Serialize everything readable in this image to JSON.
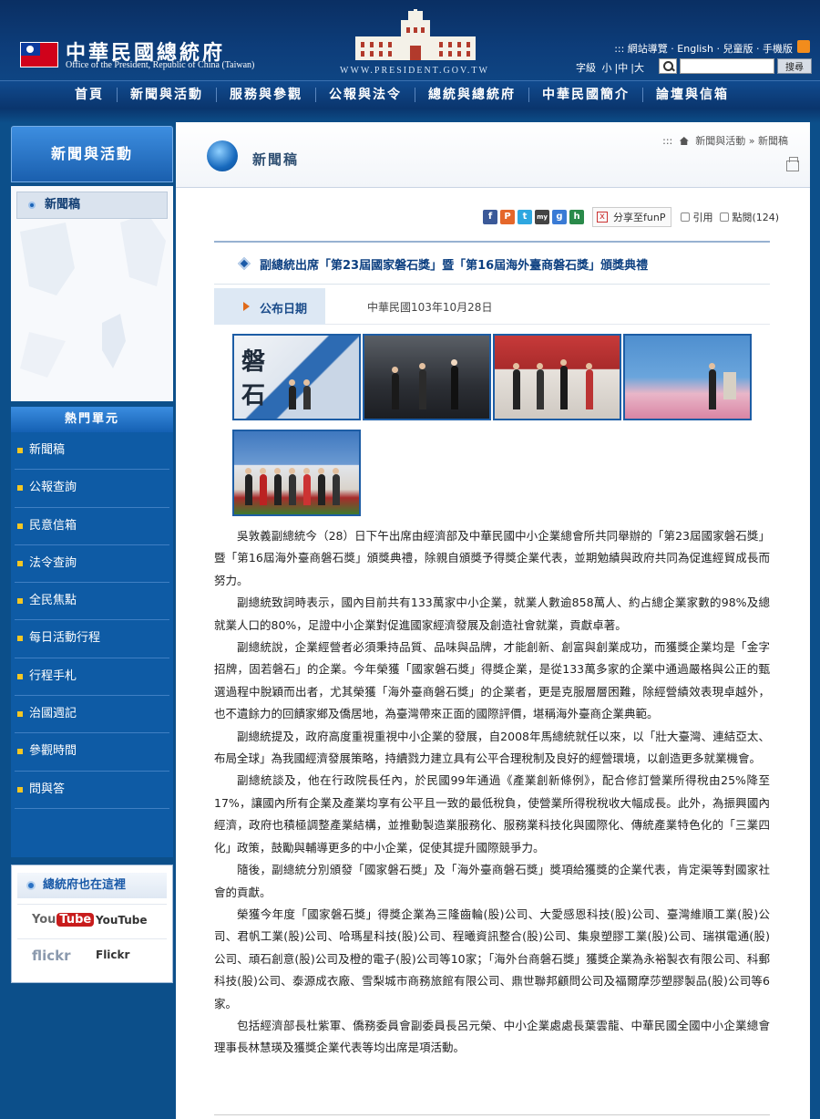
{
  "header": {
    "title": "中華民國總統府",
    "subtitle": "Office of the President, Republic of China (Taiwan)",
    "url": "WWW.PRESIDENT.GOV.TW",
    "top_links": "::: 網站導覽 · English · 兒童版 · 手機版",
    "font_size_label": "字級",
    "font_small": "小",
    "font_medium": "中",
    "font_large": "大",
    "search_placeholder": "",
    "search_button": "搜尋",
    "rss_label": "RSS"
  },
  "nav": {
    "items": [
      {
        "label": "首頁"
      },
      {
        "label": "新聞與活動"
      },
      {
        "label": "服務與參觀"
      },
      {
        "label": "公報與法令"
      },
      {
        "label": "總統與總統府"
      },
      {
        "label": "中華民國簡介"
      },
      {
        "label": "論壇與信箱"
      }
    ]
  },
  "sidebar": {
    "section_title": "新聞與活動",
    "submenu_item": "新聞稿",
    "hot_title": "熱門單元",
    "hot_items": [
      {
        "label": "新聞稿"
      },
      {
        "label": "公報查詢"
      },
      {
        "label": "民意信箱"
      },
      {
        "label": "法令查詢"
      },
      {
        "label": "全民焦點"
      },
      {
        "label": "每日活動行程"
      },
      {
        "label": "行程手札"
      },
      {
        "label": "治國週記"
      },
      {
        "label": "參觀時間"
      },
      {
        "label": "問與答"
      }
    ],
    "social_title": "總統府也在這裡",
    "youtube_logo_a": "You",
    "youtube_logo_b": "Tube",
    "youtube_label": "YouTube",
    "flickr_logo": "flickr",
    "flickr_label": "Flickr"
  },
  "content": {
    "page_title": "新聞稿",
    "breadcrumb_prefix": ":::",
    "breadcrumb": "新聞與活動 » 新聞稿",
    "share_label": "分享至funP",
    "quote_label": "引用",
    "hits_label": "點閱(124)",
    "article_title": "副總統出席「第23屆國家磐石獎」暨「第16屆海外臺商磐石獎」頒獎典禮",
    "pubdate_label": "公布日期",
    "pubdate_value": "中華民國103年10月28日",
    "paragraphs": [
      "吳敦義副總統今（28）日下午出席由經濟部及中華民國中小企業總會所共同舉辦的「第23屆國家磐石獎」暨「第16屆海外臺商磐石獎」頒獎典禮，除親自頒獎予得獎企業代表，並期勉績與政府共同為促進經貿成長而努力。",
      "副總統致詞時表示，國內目前共有133萬家中小企業，就業人數逾858萬人、約占總企業家數的98%及總就業人口的80%，足證中小企業對促進國家經濟發展及創造社會就業，貢獻卓著。",
      "副總統說，企業經營者必須秉持品質、品味與品牌，才能創新、創富與創業成功，而獲獎企業均是「金字招牌，固若磐石」的企業。今年榮獲「國家磐石獎」得獎企業，是從133萬多家的企業中通過嚴格與公正的甄選過程中脫穎而出者，尤其榮獲「海外臺商磐石獎」的企業者，更是克服層層困難，除經營績效表現卓越外，也不遺餘力的回饋家鄉及僑居地，為臺灣帶來正面的國際評價，堪稱海外臺商企業典範。",
      "副總統提及，政府高度重視重視中小企業的發展，自2008年馬總統就任以來，以「壯大臺灣、連結亞太、布局全球」為我國經濟發展策略，持續戮力建立具有公平合理稅制及良好的經營環境，以創造更多就業機會。",
      "副總統談及，他在行政院長任內，於民國99年通過《產業創新條例》，配合修訂營業所得稅由25%降至17%，讓國內所有企業及產業均享有公平且一致的最低稅負，使營業所得稅稅收大幅成長。此外，為振興國內經濟，政府也積極調整產業結構，並推動製造業服務化、服務業科技化與國際化、傳統產業特色化的「三業四化」政策，鼓勵與輔導更多的中小企業，促使其提升國際競爭力。",
      "隨後，副總統分別頒發「國家磐石獎」及「海外臺商磐石獎」獎項給獲獎的企業代表，肯定渠等對國家社會的貢獻。",
      "榮獲今年度「國家磐石獎」得獎企業為三隆齒輪(股)公司、大愛感恩科技(股)公司、臺灣維順工業(股)公司、君帆工業(股)公司、哈瑪星科技(股)公司、程曦資訊整合(股)公司、集泉塑膠工業(股)公司、瑞祺電通(股)公司、頑石創意(股)公司及橙的電子(股)公司等10家；「海外台商磐石獎」獲獎企業為永裕製衣有限公司、科郵科技(股)公司、泰源成衣廠、雪梨城市商務旅館有限公司、鼎世聯邦顧問公司及福爾摩莎塑膠製品(股)公司等6家。",
      "包括經濟部長杜紫軍、僑務委員會副委員長呂元榮、中小企業處處長葉雲龍、中華民國全國中小企業總會理事長林慧瑛及獲獎企業代表等均出席是項活動。"
    ]
  },
  "colors": {
    "brand_blue": "#0c4f8a",
    "title_blue": "#0c3f80",
    "accent_orange": "#e06a1a",
    "rss_orange": "#f28c1c"
  }
}
